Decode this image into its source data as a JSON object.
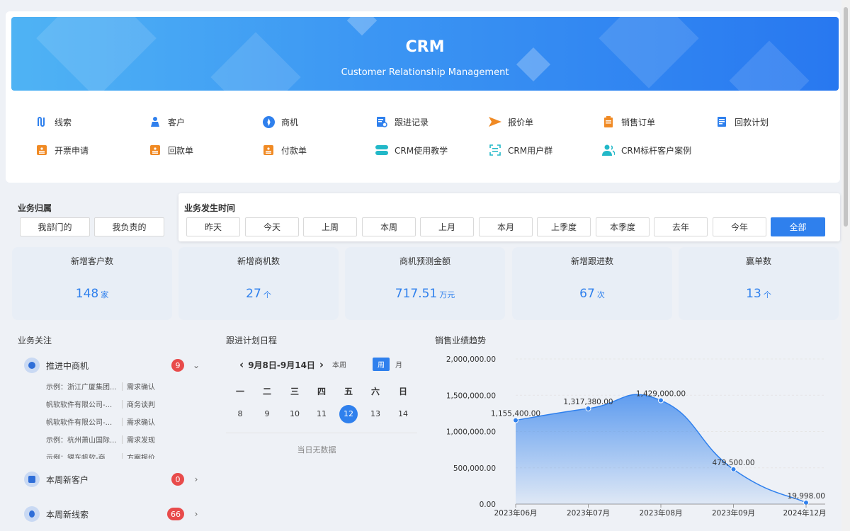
{
  "banner": {
    "title": "CRM",
    "subtitle": "Customer Relationship Management"
  },
  "shortcuts": [
    {
      "label": "线索",
      "icon": "lead-icon",
      "color": "#2f80ed"
    },
    {
      "label": "客户",
      "icon": "customer-icon",
      "color": "#2f80ed"
    },
    {
      "label": "商机",
      "icon": "opportunity-icon",
      "color": "#2f80ed"
    },
    {
      "label": "跟进记录",
      "icon": "follow-record-icon",
      "color": "#2f80ed"
    },
    {
      "label": "报价单",
      "icon": "quote-icon",
      "color": "#f08a24"
    },
    {
      "label": "销售订单",
      "icon": "sales-order-icon",
      "color": "#f08a24"
    },
    {
      "label": "回款计划",
      "icon": "payment-plan-icon",
      "color": "#2f80ed"
    },
    {
      "label": "开票申请",
      "icon": "invoice-icon",
      "color": "#f08a24"
    },
    {
      "label": "回款单",
      "icon": "payment-receipt-icon",
      "color": "#f08a24"
    },
    {
      "label": "付款单",
      "icon": "payment-icon",
      "color": "#f08a24"
    },
    {
      "label": "CRM使用教学",
      "icon": "tutorial-icon",
      "color": "#22b8c8"
    },
    {
      "label": "CRM用户群",
      "icon": "user-group-icon",
      "color": "#22b8c8"
    },
    {
      "label": "CRM标杆客户案例",
      "icon": "case-icon",
      "color": "#22b8c8"
    }
  ],
  "filters": {
    "owner_title": "业务归属",
    "owner_buttons": [
      "我部门的",
      "我负责的"
    ],
    "time_title": "业务发生时间",
    "time_buttons": [
      "昨天",
      "今天",
      "上周",
      "本周",
      "上月",
      "本月",
      "上季度",
      "本季度",
      "去年",
      "今年",
      "全部"
    ],
    "time_selected": "全部"
  },
  "stats": [
    {
      "label": "新增客户数",
      "value": "148",
      "unit": "家"
    },
    {
      "label": "新增商机数",
      "value": "27",
      "unit": "个"
    },
    {
      "label": "商机预测金额",
      "value": "717.51",
      "unit": "万元"
    },
    {
      "label": "新增跟进数",
      "value": "67",
      "unit": "次"
    },
    {
      "label": "赢单数",
      "value": "13",
      "unit": "个"
    }
  ],
  "focus": {
    "title": "业务关注",
    "groups": [
      {
        "label": "推进中商机",
        "count": "9",
        "rows": [
          {
            "name": "示例：浙江广厦集团...",
            "stage": "需求确认"
          },
          {
            "name": "帆软软件有限公司-...",
            "stage": "商务谈判"
          },
          {
            "name": "帆软软件有限公司-...",
            "stage": "需求确认"
          },
          {
            "name": "示例：杭州萧山国际...",
            "stage": "需求发现"
          },
          {
            "name": "示例：锡东帆软-商...",
            "stage": "方案报价"
          }
        ]
      },
      {
        "label": "本周新客户",
        "count": "0"
      },
      {
        "label": "本周新线索",
        "count": "66"
      }
    ]
  },
  "schedule": {
    "title": "跟进计划日程",
    "range": "9月8日-9月14日",
    "this_week": "本周",
    "view_week": "周",
    "view_month": "月",
    "weekdays": [
      "一",
      "二",
      "三",
      "四",
      "五",
      "六",
      "日"
    ],
    "days": [
      "8",
      "9",
      "10",
      "11",
      "12",
      "13",
      "14"
    ],
    "selected_day": "12",
    "empty_text": "当日无数据"
  },
  "trend": {
    "title": "销售业绩趋势"
  },
  "chart_data": {
    "type": "area",
    "title": "销售业绩趋势",
    "categories": [
      "2023年06月",
      "2023年07月",
      "2023年08月",
      "2023年09月",
      "2024年12月"
    ],
    "values": [
      1155400.0,
      1317380.0,
      1429000.0,
      479500.0,
      19998.0
    ],
    "value_labels": [
      "1,155,400.00",
      "1,317,380.00",
      "1,429,000.00",
      "479,500.00",
      "19,998.00"
    ],
    "yticks": [
      "2,000,000.00",
      "1,500,000.00",
      "1,000,000.00",
      "500,000.00",
      "0.00"
    ],
    "ylim": [
      0,
      2000000
    ],
    "grid": true,
    "color": "#2f80ed"
  }
}
